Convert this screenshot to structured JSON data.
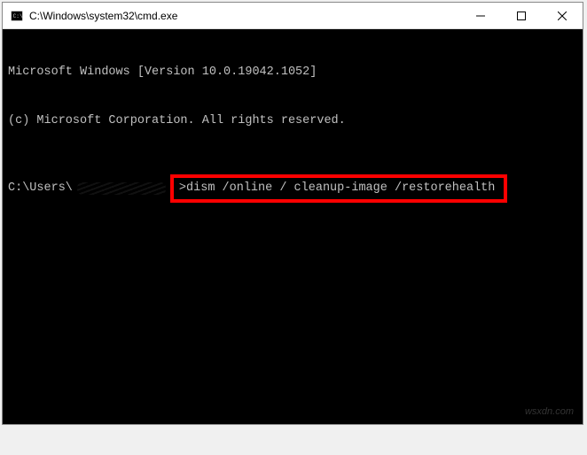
{
  "titlebar": {
    "title": "C:\\Windows\\system32\\cmd.exe"
  },
  "terminal": {
    "line1": "Microsoft Windows [Version 10.0.19042.1052]",
    "line2": "(c) Microsoft Corporation. All rights reserved.",
    "prompt_prefix": "C:\\Users\\",
    "command": ">dism /online / cleanup-image /restorehealth"
  },
  "watermark": "wsxdn.com"
}
